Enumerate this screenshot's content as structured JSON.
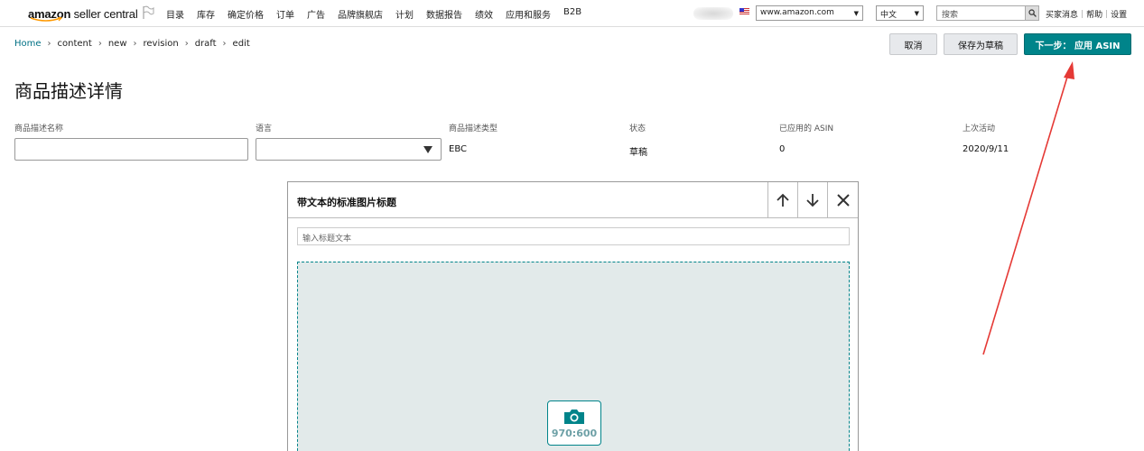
{
  "topbar": {
    "logo_text_bold": "amazon",
    "logo_text_rest": " seller central",
    "nav": [
      "目录",
      "库存",
      "确定价格",
      "订单",
      "广告",
      "品牌旗舰店",
      "计划",
      "数据报告",
      "绩效",
      "应用和服务",
      "B2B"
    ],
    "marketplace": "www.amazon.com",
    "language": "中文",
    "search_placeholder": "搜索",
    "links": [
      "买家消息",
      "帮助",
      "设置"
    ]
  },
  "breadcrumb": [
    "Home",
    "content",
    "new",
    "revision",
    "draft",
    "edit"
  ],
  "actions": {
    "cancel": "取消",
    "save_draft": "保存为草稿",
    "next": "下一步： 应用 ASIN"
  },
  "page_title": "商品描述详情",
  "fields": {
    "name_label": "商品描述名称",
    "name_value": "",
    "language_label": "语言",
    "language_value": "",
    "type_label": "商品描述类型",
    "type_value": "EBC",
    "status_label": "状态",
    "status_value": "草稿",
    "asin_label": "已应用的 ASIN",
    "asin_value": "0",
    "last_activity_label": "上次活动",
    "last_activity_value": "2020/9/11"
  },
  "module": {
    "title": "带文本的标准图片标题",
    "headline_placeholder": "输入标题文本",
    "image_size": "970:600"
  },
  "colors": {
    "primary": "#00848a",
    "dropzone_bg": "#e2eaea",
    "annotation": "#e53935"
  }
}
